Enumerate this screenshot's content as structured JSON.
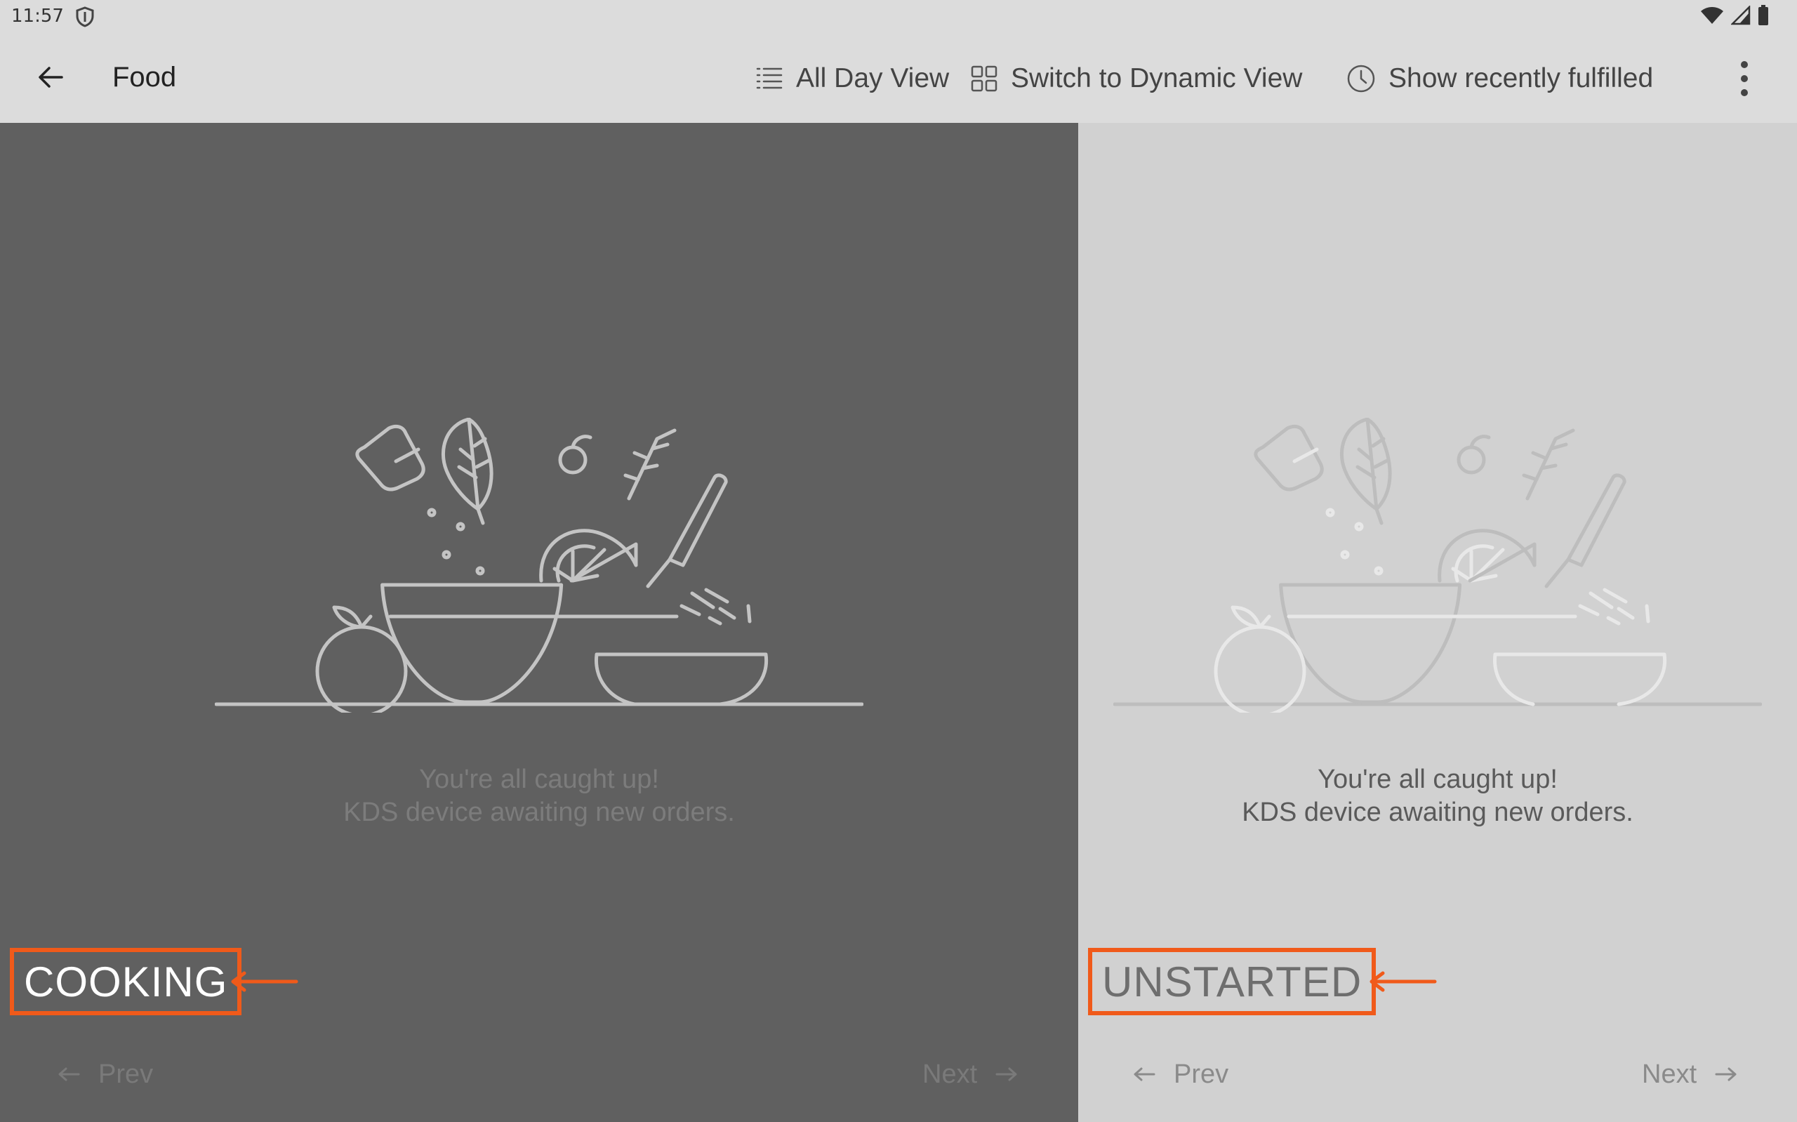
{
  "status_bar": {
    "time": "11:57"
  },
  "app_bar": {
    "title": "Food",
    "actions": {
      "all_day_view": "All Day View",
      "dynamic_view": "Switch to Dynamic View",
      "recently_fulfilled": "Show recently fulfilled"
    }
  },
  "columns": [
    {
      "status": "COOKING",
      "message_line1": "You're all caught up!",
      "message_line2": "KDS device awaiting new orders.",
      "prev_label": "Prev",
      "next_label": "Next"
    },
    {
      "status": "UNSTARTED",
      "message_line1": "You're all caught up!",
      "message_line2": "KDS device awaiting new orders.",
      "prev_label": "Prev",
      "next_label": "Next"
    }
  ],
  "colors": {
    "annotation": "#f05a1a",
    "cooking_bg": "#606060",
    "unstarted_bg": "#d1d1d1",
    "app_bar_bg": "#dcdcdc"
  },
  "icons": [
    "back-arrow-icon",
    "list-icon",
    "grid-icon",
    "clock-icon",
    "more-vert-icon",
    "shield-icon",
    "wifi-icon",
    "cell-signal-icon",
    "battery-icon",
    "arrow-left-icon",
    "arrow-right-icon"
  ]
}
